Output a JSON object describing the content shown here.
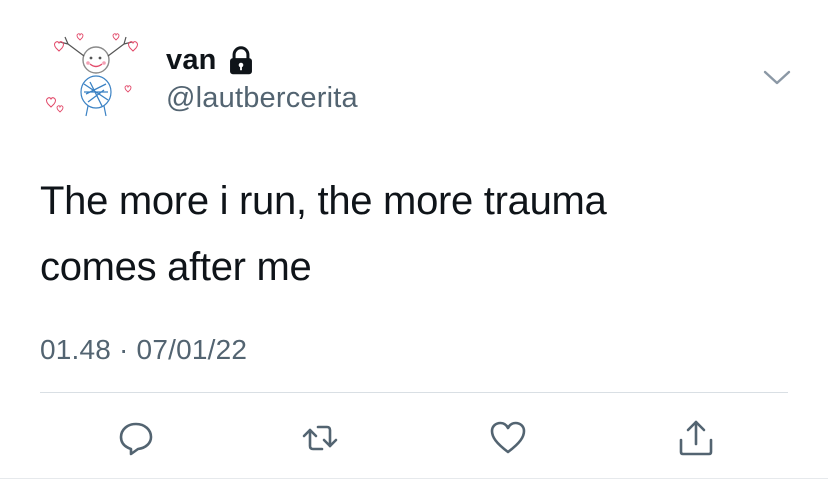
{
  "tweet": {
    "display_name": "van",
    "handle": "@lautbercerita",
    "text_lines": [
      "The more i run, the more trauma",
      "comes after me"
    ],
    "timestamp": "01.48 · 07/01/22"
  },
  "icons": {
    "lock": "lock-icon",
    "chevron": "chevron-down-icon",
    "reply": "reply-icon",
    "retweet": "retweet-icon",
    "like": "heart-icon",
    "share": "share-icon"
  },
  "colors": {
    "text": "#0f1419",
    "secondary": "#536471",
    "divider": "#d9dfe4"
  }
}
